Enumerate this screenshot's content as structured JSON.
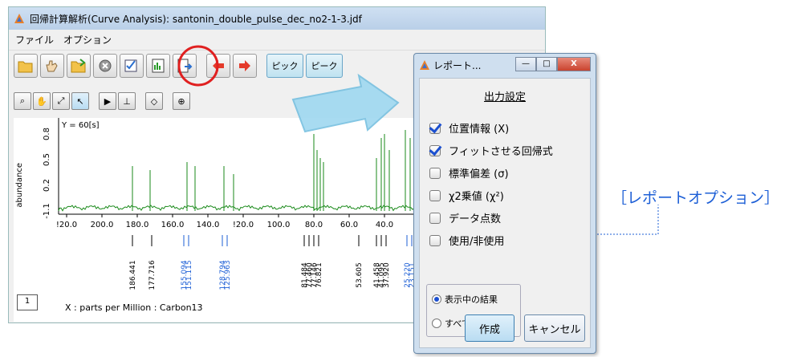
{
  "window": {
    "title": "回帰計算解析(Curve Analysis): santonin_double_pulse_dec_no2-1-3.jdf"
  },
  "menu": [
    "ファイル",
    "オプション"
  ],
  "toolbar": {
    "peak1": "ピック",
    "peak2": "ピーク"
  },
  "plot": {
    "y_annotation": "Y = 60[s]",
    "y_label": "abundance",
    "y_ticks": [
      "0.8",
      "0.5",
      "0.2",
      "-1.1"
    ],
    "x_ticks": [
      "!20.0",
      "200.0",
      "180.0",
      "160.0",
      "140.0",
      "!20.0",
      "100.0",
      "80.0",
      "60.0",
      "40.0",
      "20."
    ],
    "peak_labels_black": [
      "186.441",
      "177.716",
      "81.484",
      "77.460",
      "77.146",
      "76.821",
      "53.605",
      "41.458",
      "41.095",
      "37.920"
    ],
    "peak_labels_blue": [
      "155.094",
      "151.115",
      "128.794",
      "125.963",
      "25.220",
      "23.151"
    ],
    "x_caption": "X : parts per Million : Carbon13",
    "page_number": "1"
  },
  "dialog": {
    "title": "レポート...",
    "section_title": "出力設定",
    "options": [
      {
        "label": "位置情報 (X)",
        "checked": true
      },
      {
        "label": "フィットさせる回帰式",
        "checked": true
      },
      {
        "label": "標準偏差 (σ)",
        "checked": false
      },
      {
        "label": "χ2乗値 (χ²)",
        "checked": false
      },
      {
        "label": "データ点数",
        "checked": false
      },
      {
        "label": "使用/非使用",
        "checked": false
      }
    ],
    "radio": [
      {
        "label": "表示中の結果",
        "selected": true
      },
      {
        "label": "すべての結果",
        "selected": false
      }
    ],
    "create_label": "作成",
    "cancel_label": "キャンセル",
    "minimize": "—",
    "maximize": "□",
    "close": "X"
  },
  "callout": {
    "text": "［レポートオプション］"
  },
  "colors": {
    "spectrum": "#1a8a1a",
    "accent_blue": "#1d5fd6",
    "highlight_red": "#e02020"
  }
}
